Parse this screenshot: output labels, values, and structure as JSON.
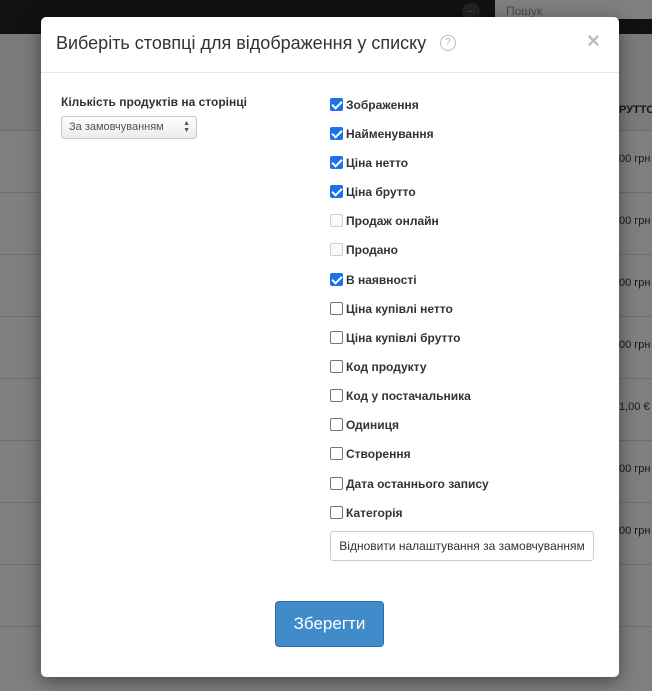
{
  "background": {
    "menu_dots": "...",
    "search_placeholder": "Пошук",
    "column_header": "РУТТО",
    "cells": [
      "00 грн",
      "00 грн",
      "00 грн",
      "00 грн",
      "1,00 €",
      "00 грн",
      "00 грн"
    ]
  },
  "modal": {
    "title": "Виберіть стовпці для відображення у списку",
    "help_glyph": "?",
    "close_glyph": "×",
    "per_page": {
      "label": "Кількість продуктів на сторінці",
      "selected": "За замовчуванням"
    },
    "columns": [
      {
        "label": "Зображення",
        "checked": true,
        "disabled": false
      },
      {
        "label": "Найменування",
        "checked": true,
        "disabled": false
      },
      {
        "label": "Ціна нетто",
        "checked": true,
        "disabled": false
      },
      {
        "label": "Ціна брутто",
        "checked": true,
        "disabled": false
      },
      {
        "label": "Продаж онлайн",
        "checked": false,
        "disabled": true
      },
      {
        "label": "Продано",
        "checked": false,
        "disabled": true
      },
      {
        "label": "В наявності",
        "checked": true,
        "disabled": false
      },
      {
        "label": "Ціна купівлі нетто",
        "checked": false,
        "disabled": false
      },
      {
        "label": "Ціна купівлі брутто",
        "checked": false,
        "disabled": false
      },
      {
        "label": "Код продукту",
        "checked": false,
        "disabled": false
      },
      {
        "label": "Код у постачальника",
        "checked": false,
        "disabled": false
      },
      {
        "label": "Одиниця",
        "checked": false,
        "disabled": false
      },
      {
        "label": "Створення",
        "checked": false,
        "disabled": false
      },
      {
        "label": "Дата останнього запису",
        "checked": false,
        "disabled": false
      },
      {
        "label": "Категорія",
        "checked": false,
        "disabled": false
      }
    ],
    "reset_label": "Відновити налаштування за замовчуванням",
    "save_label": "Зберегти",
    "accent_color": "#428bca"
  }
}
